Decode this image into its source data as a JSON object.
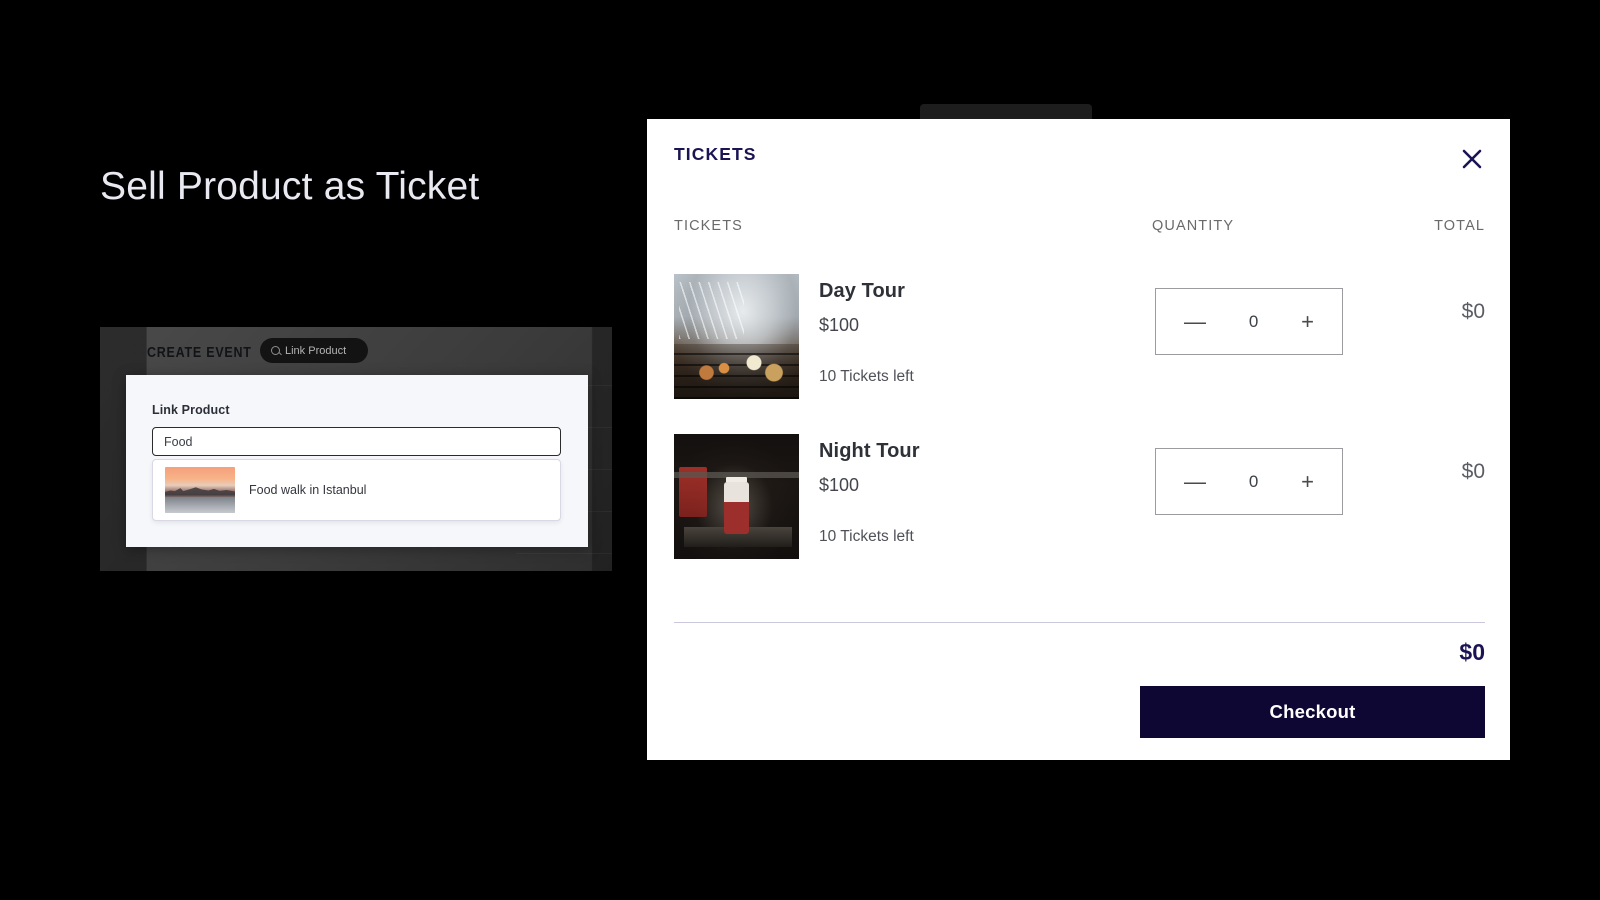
{
  "promo": {
    "headline": "Sell Product as Ticket"
  },
  "builder": {
    "app_title": "CREATE EVENT",
    "link_pill_label": "Link Product",
    "search_icon": "search-icon",
    "panel": {
      "field_label": "Link Product",
      "input_value": "Food",
      "results": [
        {
          "title": "Food walk in Istanbul",
          "thumbnail": "istanbul-skyline-sunset-thumbnail"
        }
      ]
    }
  },
  "modal": {
    "title": "TICKETS",
    "close_icon": "close-icon",
    "columns": {
      "tickets": "TICKETS",
      "quantity": "QUANTITY",
      "total": "TOTAL"
    },
    "tickets": [
      {
        "name": "Day Tour",
        "price": "$100",
        "availability": "10 Tickets left",
        "quantity": "0",
        "line_total": "$0",
        "thumbnail": "bbq-grill-smoke-thumbnail",
        "decrement_label": "—",
        "increment_label": "+"
      },
      {
        "name": "Night Tour",
        "price": "$100",
        "availability": "10 Tickets left",
        "quantity": "0",
        "line_total": "$0",
        "thumbnail": "night-street-food-stall-thumbnail",
        "decrement_label": "—",
        "increment_label": "+"
      }
    ],
    "grand_total": "$0",
    "checkout_label": "Checkout"
  },
  "colors": {
    "brand_navy": "#1b1454",
    "checkout_bg": "#0e0733",
    "page_bg": "#000000",
    "panel_bg": "#ffffff",
    "divider": "#c9c8dc",
    "muted_text": "#6a6a6a"
  }
}
